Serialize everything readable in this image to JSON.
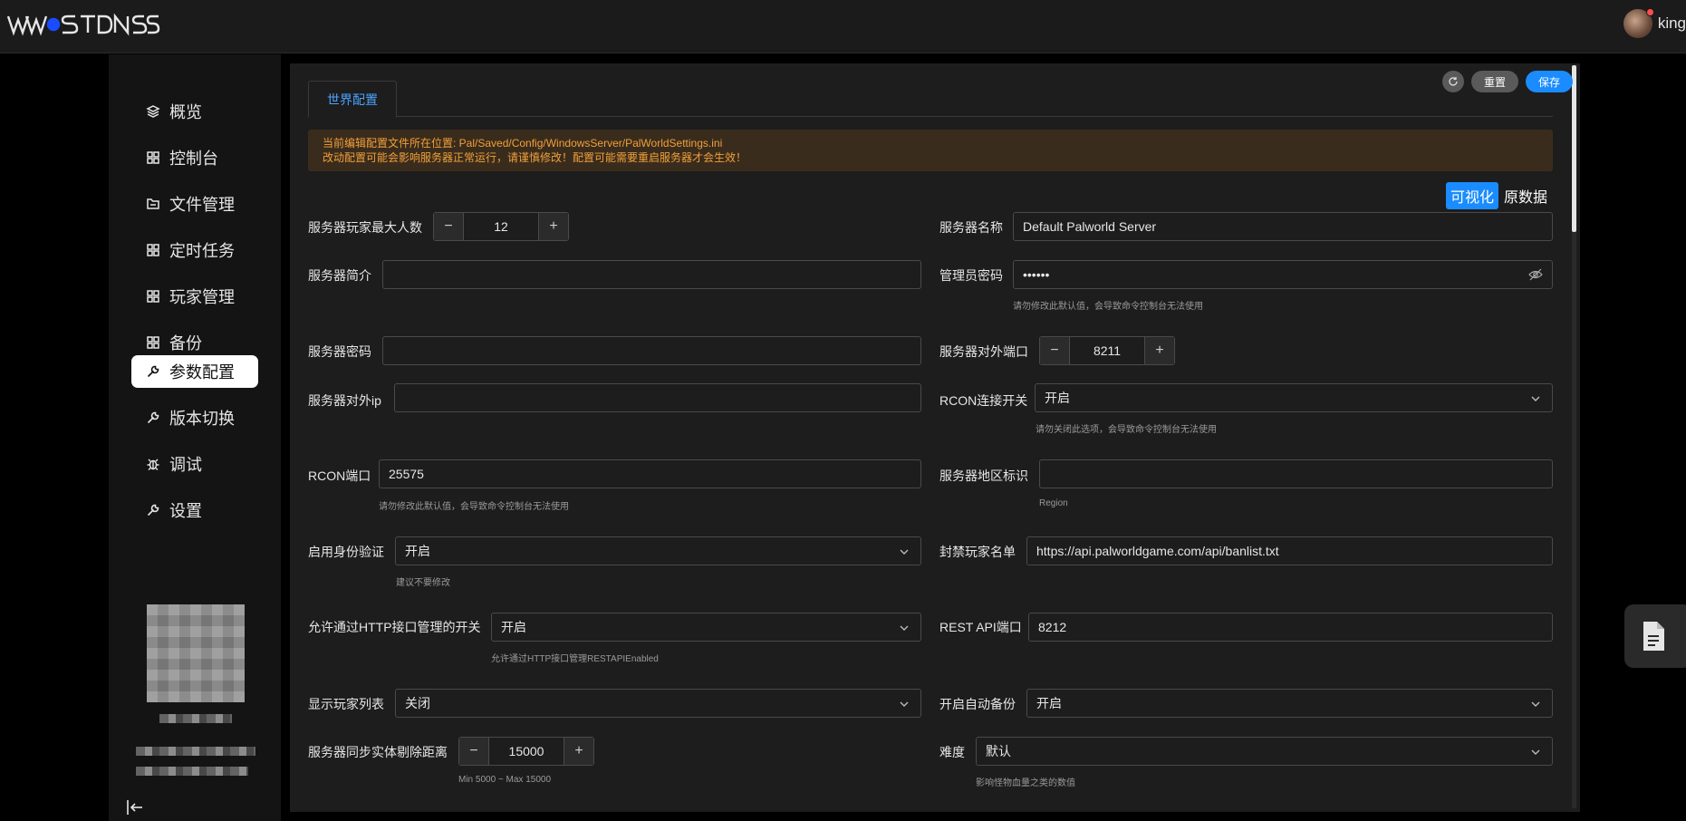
{
  "header": {
    "logo_text": "WSTDNSS",
    "username": "king"
  },
  "sidebar": {
    "items": [
      {
        "label": "概览",
        "icon": "layers-icon"
      },
      {
        "label": "控制台",
        "icon": "grid-icon"
      },
      {
        "label": "文件管理",
        "icon": "folder-icon"
      },
      {
        "label": "定时任务",
        "icon": "grid-icon"
      },
      {
        "label": "玩家管理",
        "icon": "grid-icon"
      },
      {
        "label": "备份",
        "icon": "grid-icon"
      },
      {
        "label": "参数配置",
        "icon": "wrench-icon",
        "active": true
      },
      {
        "label": "版本切换",
        "icon": "wrench-icon"
      },
      {
        "label": "调试",
        "icon": "bug-icon"
      },
      {
        "label": "设置",
        "icon": "wrench-icon"
      }
    ]
  },
  "toolbar": {
    "refresh_icon": "refresh-icon",
    "reset_label": "重置",
    "save_label": "保存"
  },
  "tabs": [
    {
      "label": "世界配置",
      "active": true
    }
  ],
  "alert": {
    "line1": "当前编辑配置文件所在位置: Pal/Saved/Config/WindowsServer/PalWorldSettings.ini",
    "line2": "改动配置可能会影响服务器正常运行，请谨慎修改！配置可能需要重启服务器才会生效！"
  },
  "mode": {
    "visual": "可视化",
    "raw": "原数据"
  },
  "form": {
    "max_players": {
      "label": "服务器玩家最大人数",
      "value": "12"
    },
    "server_name": {
      "label": "服务器名称",
      "value": "Default Palworld Server"
    },
    "server_desc": {
      "label": "服务器简介",
      "value": ""
    },
    "admin_password": {
      "label": "管理员密码",
      "value": "••••••",
      "hint": "请勿修改此默认值，会导致命令控制台无法使用"
    },
    "server_password": {
      "label": "服务器密码",
      "value": ""
    },
    "public_port": {
      "label": "服务器对外端口",
      "value": "8211"
    },
    "public_ip": {
      "label": "服务器对外ip",
      "value": ""
    },
    "rcon_enabled": {
      "label": "RCON连接开关",
      "value": "开启",
      "hint": "请勿关闭此选项，会导致命令控制台无法使用"
    },
    "rcon_port": {
      "label": "RCON端口",
      "value": "25575",
      "hint": "请勿修改此默认值，会导致命令控制台无法使用"
    },
    "region": {
      "label": "服务器地区标识",
      "value": "",
      "hint": "Region"
    },
    "auth": {
      "label": "启用身份验证",
      "value": "开启",
      "hint": "建议不要修改"
    },
    "banlist": {
      "label": "封禁玩家名单",
      "value": "https://api.palworldgame.com/api/banlist.txt"
    },
    "rest_api": {
      "label": "允许通过HTTP接口管理的开关",
      "value": "开启",
      "hint": "允许通过HTTP接口管理RESTAPIEnabled"
    },
    "rest_port": {
      "label": "REST API端口",
      "value": "8212"
    },
    "show_players": {
      "label": "显示玩家列表",
      "value": "关闭"
    },
    "auto_backup": {
      "label": "开启自动备份",
      "value": "开启"
    },
    "sync_distance": {
      "label": "服务器同步实体剔除距离",
      "value": "15000",
      "hint": "Min 5000 ~ Max 15000"
    },
    "difficulty": {
      "label": "难度",
      "value": "默认",
      "hint": "影响怪物血量之类的数值"
    }
  }
}
